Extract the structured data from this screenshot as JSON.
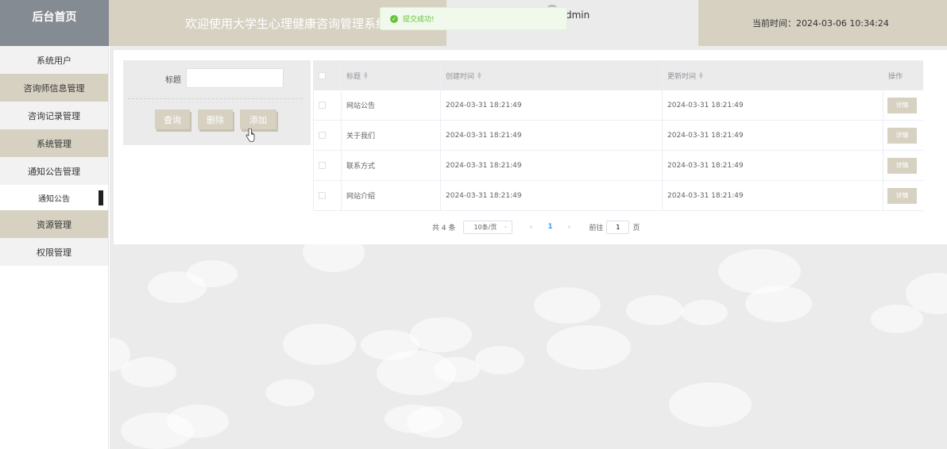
{
  "header": {
    "brand": "后台首页",
    "welcome": "欢迎使用大学生心理健康咨询管理系统",
    "username": "dmin",
    "time_label": "当前时间：",
    "time_value": "2024-03-06 10:34:24"
  },
  "toast": {
    "message": "提交成功!",
    "color": "#67c23a"
  },
  "sidebar": {
    "items": [
      {
        "label": "系统用户"
      },
      {
        "label": "咨询师信息管理"
      },
      {
        "label": "咨询记录管理"
      },
      {
        "label": "系统管理"
      },
      {
        "label": "通知公告管理"
      },
      {
        "label": "通知公告"
      },
      {
        "label": "资源管理"
      },
      {
        "label": "权限管理"
      }
    ]
  },
  "search": {
    "title_label": "标题",
    "title_value": "",
    "title_placeholder": "",
    "query_label": "查询",
    "delete_label": "删除",
    "add_label": "添加"
  },
  "table": {
    "headers": {
      "title": "标题",
      "created": "创建时间",
      "updated": "更新时间",
      "action": "操作"
    },
    "detail_label": "详情",
    "rows": [
      {
        "title": "网站公告",
        "created": "2024-03-31 18:21:49",
        "updated": "2024-03-31 18:21:49"
      },
      {
        "title": "关于我们",
        "created": "2024-03-31 18:21:49",
        "updated": "2024-03-31 18:21:49"
      },
      {
        "title": "联系方式",
        "created": "2024-03-31 18:21:49",
        "updated": "2024-03-31 18:21:49"
      },
      {
        "title": "网站介绍",
        "created": "2024-03-31 18:21:49",
        "updated": "2024-03-31 18:21:49"
      }
    ]
  },
  "pagination": {
    "total": "共 4 条",
    "page_size": "10条/页",
    "current_page": "1",
    "goto_label": "前往",
    "goto_value": "1",
    "page_suffix": "页"
  },
  "colors": {
    "accent": "#d7d1c2",
    "brand_bg": "#858b93",
    "main_bg": "#ebebeb"
  }
}
